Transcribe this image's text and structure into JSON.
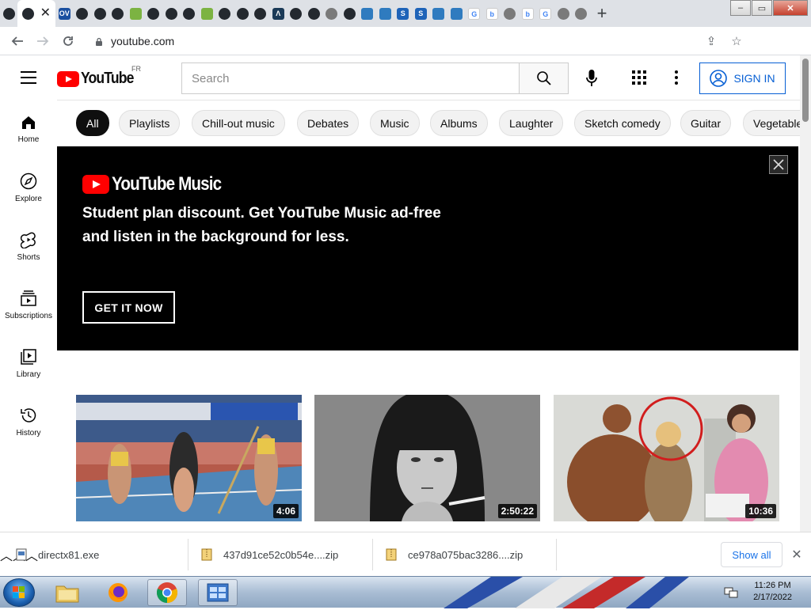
{
  "browser": {
    "tabs": [
      {
        "icon": "github-icon",
        "color": "#24292f"
      },
      {
        "icon": "github-icon",
        "color": "#24292f"
      },
      {
        "icon": "ov-icon",
        "color": "#1a4fa0",
        "text": "OV"
      },
      {
        "icon": "github-icon",
        "color": "#24292f"
      },
      {
        "icon": "github-icon",
        "color": "#24292f"
      },
      {
        "icon": "github-icon",
        "color": "#24292f"
      },
      {
        "icon": "gear-green-icon",
        "color": "#7cb342"
      },
      {
        "icon": "github-icon",
        "color": "#24292f"
      },
      {
        "icon": "github-icon",
        "color": "#24292f"
      },
      {
        "icon": "github-icon",
        "color": "#24292f"
      },
      {
        "icon": "gear-green-icon",
        "color": "#7cb342"
      },
      {
        "icon": "github-icon",
        "color": "#24292f"
      },
      {
        "icon": "github-icon",
        "color": "#24292f"
      },
      {
        "icon": "github-icon",
        "color": "#24292f"
      },
      {
        "icon": "lambda-icon",
        "color": "#1b3a57",
        "text": "Λ"
      },
      {
        "icon": "github-icon",
        "color": "#24292f"
      },
      {
        "icon": "github-icon",
        "color": "#24292f"
      },
      {
        "icon": "globe-icon",
        "color": "#7a7a7a"
      },
      {
        "icon": "github-icon",
        "color": "#24292f"
      },
      {
        "icon": "play-icon",
        "color": "#2f7bbf"
      },
      {
        "icon": "play-icon",
        "color": "#2f7bbf"
      },
      {
        "icon": "s-icon",
        "color": "#1e63b8",
        "text": "S"
      },
      {
        "icon": "s-icon",
        "color": "#1e63b8",
        "text": "S"
      },
      {
        "icon": "play-icon",
        "color": "#2f7bbf"
      },
      {
        "icon": "play-icon",
        "color": "#2f7bbf"
      },
      {
        "icon": "google-icon",
        "color": "#ffffff",
        "text": "G"
      },
      {
        "icon": "bing-icon",
        "color": "#ffffff",
        "text": "b"
      },
      {
        "icon": "globe-icon",
        "color": "#7a7a7a"
      },
      {
        "icon": "bing-icon",
        "color": "#ffffff",
        "text": "b"
      },
      {
        "icon": "google-icon",
        "color": "#ffffff",
        "text": "G"
      },
      {
        "icon": "globe-icon",
        "color": "#7a7a7a"
      },
      {
        "icon": "globe-icon",
        "color": "#7a7a7a"
      }
    ],
    "url": "youtube.com"
  },
  "youtube": {
    "logo_text": "YouTube",
    "country_code": "FR",
    "search_placeholder": "Search",
    "sign_in": "SIGN IN",
    "guide": [
      {
        "label": "Home",
        "icon": "home-icon"
      },
      {
        "label": "Explore",
        "icon": "compass-icon"
      },
      {
        "label": "Shorts",
        "icon": "shorts-icon"
      },
      {
        "label": "Subscriptions",
        "icon": "subscriptions-icon"
      },
      {
        "label": "Library",
        "icon": "library-icon"
      },
      {
        "label": "History",
        "icon": "history-icon"
      }
    ],
    "chips": [
      "All",
      "Playlists",
      "Chill-out music",
      "Debates",
      "Music",
      "Albums",
      "Laughter",
      "Sketch comedy",
      "Guitar",
      "Vegetables"
    ],
    "banner": {
      "logo_text": "YouTube Music",
      "headline": "Student plan discount. Get YouTube Music ad-free and listen in the background for less.",
      "cta": "GET IT NOW"
    },
    "videos": [
      {
        "duration": "4:06"
      },
      {
        "duration": "2:50:22"
      },
      {
        "duration": "10:36"
      }
    ]
  },
  "downloads": {
    "items": [
      "directx81.exe",
      "437d91ce52c0b54e....zip",
      "ce978a075bac3286....zip"
    ],
    "show_all": "Show all"
  },
  "taskbar": {
    "time": "11:26 PM",
    "date": "2/17/2022"
  }
}
